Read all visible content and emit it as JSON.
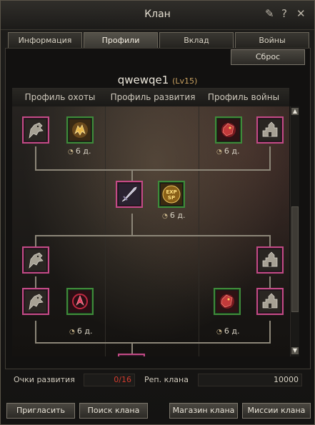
{
  "window": {
    "title": "Клан"
  },
  "tabs": [
    {
      "label": "Информация",
      "active": false
    },
    {
      "label": "Профили",
      "active": true
    },
    {
      "label": "Вклад",
      "active": false
    },
    {
      "label": "Войны",
      "active": false
    }
  ],
  "reset_label": "Сброс",
  "member": {
    "name": "qwewqe1",
    "level": "(Lv15)"
  },
  "columns": [
    "Профиль охоты",
    "Профиль развития",
    "Профиль войны"
  ],
  "durations": {
    "d1": "6 д.",
    "d2": "6 д.",
    "d3": "6 д.",
    "d4": "6 д.",
    "d5": "6 д."
  },
  "skill_icons": {
    "exp_sp": {
      "line1": "EXP",
      "line2": "SP"
    }
  },
  "stats": {
    "dev_points_label": "Очки развития",
    "dev_points_value": "0/16",
    "rep_label": "Реп. клана",
    "rep_value": "10000"
  },
  "footer": {
    "invite": "Пригласить",
    "search": "Поиск клана",
    "shop": "Магазин клана",
    "missions": "Миссии клана"
  },
  "colors": {
    "skill_border_pink": "#c24a86",
    "skill_border_green": "#3e8a3a",
    "dev_points_value": "#d23b2e",
    "level": "#c8a060"
  }
}
